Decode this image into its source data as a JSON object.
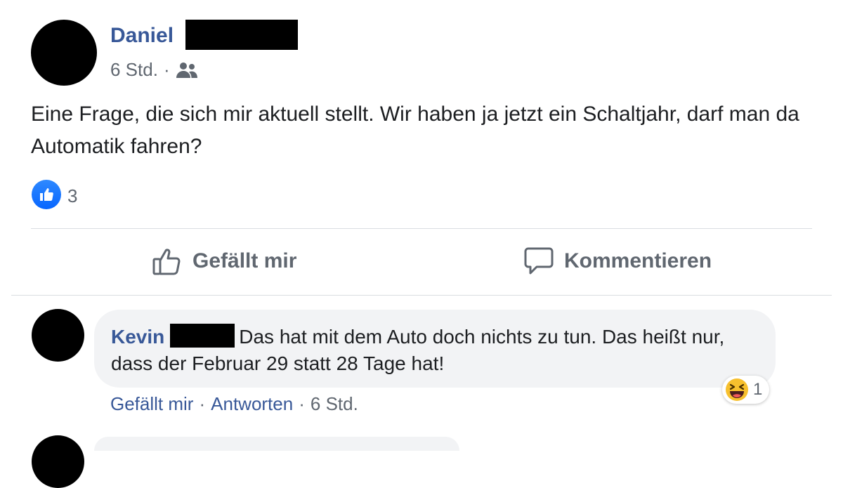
{
  "post": {
    "author_first_name": "Daniel",
    "timestamp": "6 Std.",
    "separator": "·",
    "audience_icon": "friends-icon",
    "text": "Eine Frage, die sich mir aktuell stellt. Wir haben ja jetzt ein Schaltjahr, darf man da Automatik fahren?",
    "reaction_icon": "thumbs-up-icon",
    "reaction_count": "3"
  },
  "actions": {
    "like_label": "Gefällt mir",
    "comment_label": "Kommentieren"
  },
  "comment": {
    "author_first_name": "Kevin",
    "text": "Das hat mit dem Auto doch nichts zu tun. Das heißt nur, dass der Februar 29 statt 28 Tage hat!",
    "like_link": "Gefällt mir",
    "reply_link": "Antworten",
    "timestamp": "6 Std.",
    "separator": "·",
    "reaction_icon": "laughing-emoji-icon",
    "reaction_count": "1"
  },
  "colors": {
    "name_link": "#385898",
    "secondary_text": "#606770",
    "like_blue": "#1877f2",
    "bubble_bg": "#f2f3f5"
  }
}
